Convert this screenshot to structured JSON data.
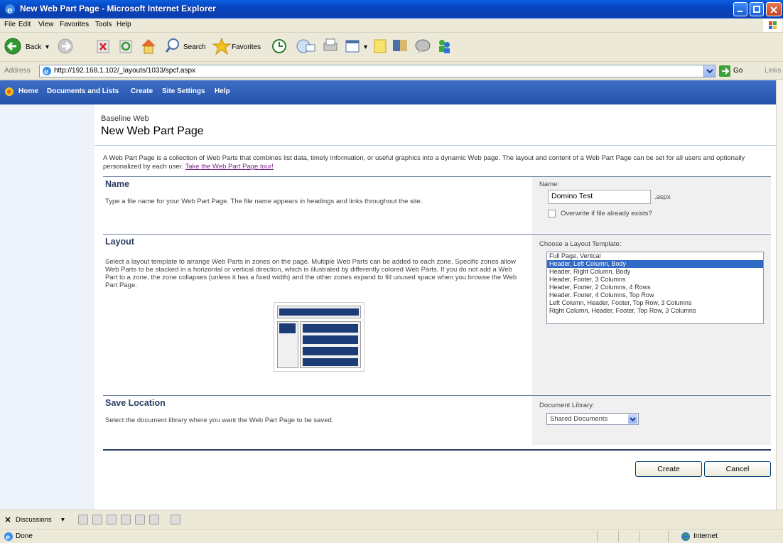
{
  "window": {
    "title": "New Web Part Page - Microsoft Internet Explorer"
  },
  "menu": [
    "File",
    "Edit",
    "View",
    "Favorites",
    "Tools",
    "Help"
  ],
  "toolbar": {
    "back": "Back",
    "search": "Search",
    "favorites": "Favorites"
  },
  "address": {
    "label": "Address",
    "url": "http://192.168.1.102/_layouts/1033/spcf.aspx",
    "go": "Go",
    "links": "Links"
  },
  "nav": [
    "Home",
    "Documents and Lists",
    "Create",
    "Site Settings",
    "Help"
  ],
  "page": {
    "breadcrumb": "Baseline Web",
    "title": "New Web Part Page",
    "intro": "A Web Part Page is a collection of Web Parts that combines list data, timely information, or useful graphics into a dynamic Web page. The layout and content of a Web Part Page can be set for all users and optionally personalized by each user.",
    "tour_link": "Take the Web Part Page tour!"
  },
  "name_section": {
    "heading": "Name",
    "description": "Type a file name for your Web Part Page. The file name appears in headings and links throughout the site.",
    "field_label": "Name:",
    "value": "Domino Test",
    "extension": ".aspx",
    "overwrite_label": "Overwrite if file already exists?"
  },
  "layout_section": {
    "heading": "Layout",
    "description": "Select a layout template to arrange Web Parts in zones on the page. Multiple Web Parts can be added to each zone. Specific zones allow Web Parts to be stacked in a horizontal or vertical direction, which is illustrated by differently colored Web Parts. If you do not add a Web Part to a zone, the zone collapses (unless it has a fixed width) and the other zones expand to fill unused space when you browse the Web Part Page.",
    "field_label": "Choose a Layout Template:",
    "options": [
      "Full Page, Vertical",
      "Header, Left Column, Body",
      "Header, Right Column, Body",
      "Header, Footer, 3 Columns",
      "Header, Footer, 2 Columns, 4 Rows",
      "Header, Footer, 4 Columns, Top Row",
      "Left Column, Header, Footer, Top Row, 3 Columns",
      "Right Column, Header, Footer, Top Row, 3 Columns"
    ],
    "selected": "Header, Left Column, Body"
  },
  "save_section": {
    "heading": "Save Location",
    "description": "Select the document library where you want the Web Part Page to be saved.",
    "field_label": "Document Library:",
    "value": "Shared Documents"
  },
  "buttons": {
    "create": "Create",
    "cancel": "Cancel"
  },
  "discussions": {
    "label": "Discussions"
  },
  "status": {
    "text": "Done",
    "zone": "Internet"
  },
  "colors": {
    "nav_blue": "#2452a8",
    "heading": "#2c3e66",
    "selected": "#316ac5",
    "preview_fill": "#1b3c77"
  }
}
